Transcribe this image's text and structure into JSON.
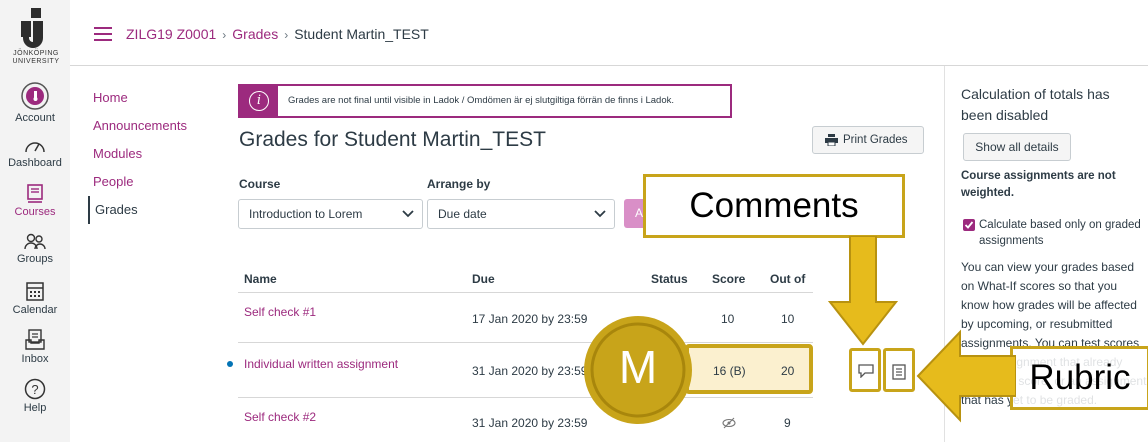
{
  "global_nav": {
    "logo_text": "JÖNKÖPING UNIVERSITY",
    "items": [
      {
        "label": "Account",
        "icon": "account-icon"
      },
      {
        "label": "Dashboard",
        "icon": "dashboard-icon"
      },
      {
        "label": "Courses",
        "icon": "courses-icon"
      },
      {
        "label": "Groups",
        "icon": "groups-icon"
      },
      {
        "label": "Calendar",
        "icon": "calendar-icon"
      },
      {
        "label": "Inbox",
        "icon": "inbox-icon"
      },
      {
        "label": "Help",
        "icon": "help-icon"
      }
    ]
  },
  "breadcrumbs": {
    "course": "ZILG19 Z0001",
    "section": "Grades",
    "page": "Student Martin_TEST"
  },
  "course_nav": {
    "items": [
      "Home",
      "Announcements",
      "Modules",
      "People",
      "Grades"
    ]
  },
  "notice": "Grades are not final until visible in Ladok / Omdömen är ej slutgiltiga förrän de finns i Ladok.",
  "page_title": "Grades for Student Martin_TEST",
  "print_label": "Print Grades",
  "filters": {
    "course_label": "Course",
    "course_value": "Introduction to Lorem",
    "arrange_label": "Arrange by",
    "arrange_value": "Due date",
    "apply_label": "Apply"
  },
  "table": {
    "headers": {
      "name": "Name",
      "due": "Due",
      "status": "Status",
      "score": "Score",
      "out_of": "Out of"
    },
    "rows": [
      {
        "name": "Self check #1",
        "due": "17 Jan 2020 by 23:59",
        "score": "10",
        "out_of": "10"
      },
      {
        "name": "Individual written assignment",
        "due": "31 Jan 2020 by 23:59",
        "score": "16 (B)",
        "out_of": "20"
      },
      {
        "name": "Self check #2",
        "due": "31 Jan 2020 by 23:59",
        "score": "",
        "out_of": "9"
      }
    ]
  },
  "sidebar": {
    "calc_disabled": "Calculation of totals has been disabled",
    "show_details": "Show all details",
    "weighting": "Course assignments are not weighted.",
    "checkbox_label": "Calculate based only on graded assignments",
    "whatif_text": "You can view your grades based on What-If scores so that you know how grades will be affected by upcoming, or resubmitted assignments. You can test scores for an assignment that already includes a score, or an assignment that has yet to be graded."
  },
  "annotations": {
    "comments": "Comments",
    "rubric": "Rubric",
    "grade_badge": "M"
  },
  "colors": {
    "brand": "#9c2a7e",
    "highlight": "#c8a41a",
    "link": "#9c2a7e"
  }
}
